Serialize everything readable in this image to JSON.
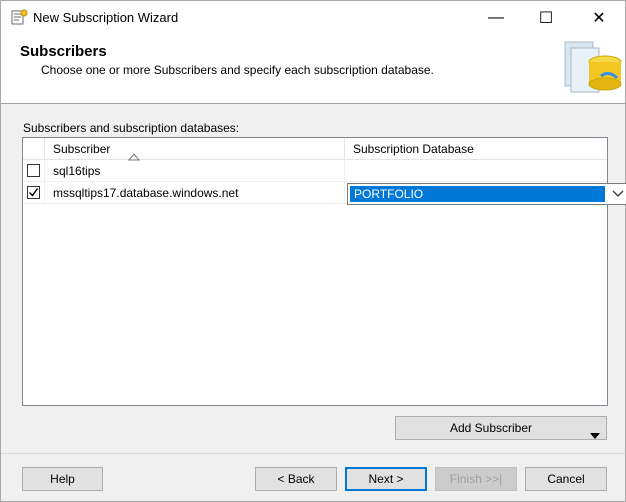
{
  "window": {
    "title": "New Subscription Wizard",
    "minimize_glyph": "—",
    "maximize_glyph": "☐",
    "close_glyph": "✕"
  },
  "header": {
    "title": "Subscribers",
    "subtitle": "Choose one or more Subscribers and specify each subscription database."
  },
  "grid": {
    "label": "Subscribers and subscription databases:",
    "columns": [
      "Subscriber",
      "Subscription Database"
    ],
    "rows": [
      {
        "checked": false,
        "subscriber": "sql16tips",
        "database": ""
      },
      {
        "checked": true,
        "subscriber": "mssqltips17.database.windows.net",
        "database": "PORTFOLIO"
      }
    ]
  },
  "buttons": {
    "add_subscriber": "Add Subscriber",
    "help": "Help",
    "back": "< Back",
    "next": "Next >",
    "finish": "Finish >>|",
    "cancel": "Cancel"
  },
  "colors": {
    "selection": "#0078d7",
    "dialog_bg": "#f0f0f0"
  }
}
